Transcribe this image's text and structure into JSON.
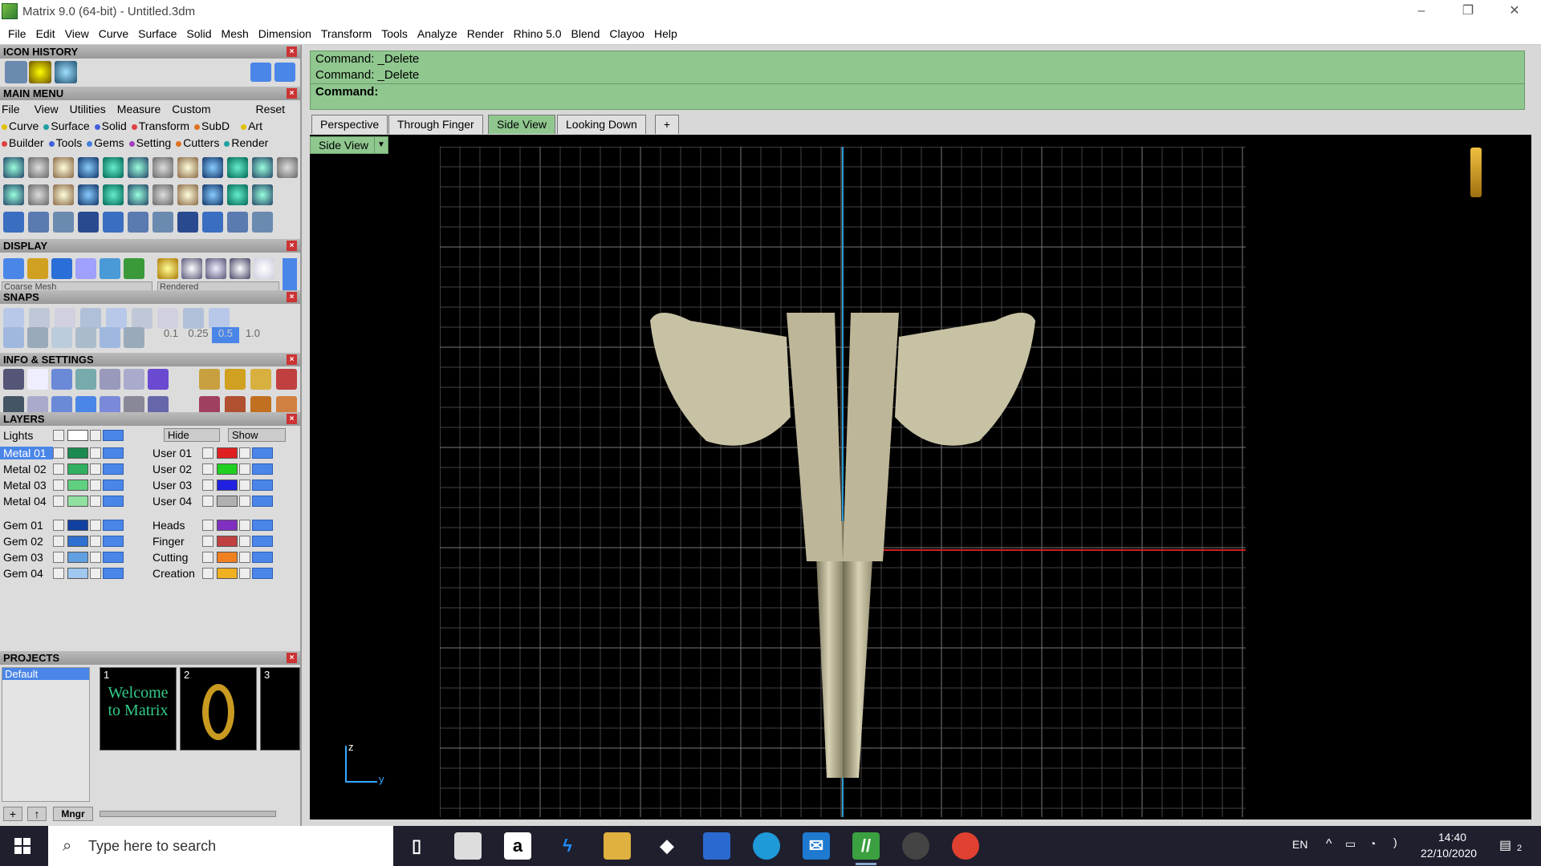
{
  "window": {
    "title": "Matrix 9.0 (64-bit) - Untitled.3dm",
    "minimize": "–",
    "restore": "❐",
    "close": "✕"
  },
  "menu": [
    "File",
    "Edit",
    "View",
    "Curve",
    "Surface",
    "Solid",
    "Mesh",
    "Dimension",
    "Transform",
    "Tools",
    "Analyze",
    "Render",
    "Rhino 5.0",
    "Blend",
    "Clayoo",
    "Help"
  ],
  "panel": {
    "icon_history": "ICON HISTORY",
    "main_menu": "MAIN MENU",
    "main_menu_items": [
      "File",
      "View",
      "Utilities",
      "Measure",
      "Custom"
    ],
    "reset": "Reset",
    "categories_row1": [
      {
        "label": "Curve",
        "color": "#e0c000"
      },
      {
        "label": "Surface",
        "color": "#20a0a0"
      },
      {
        "label": "Solid",
        "color": "#4060e0"
      },
      {
        "label": "Transform",
        "color": "#e04040"
      },
      {
        "label": "SubD",
        "color": "#e07020"
      },
      {
        "label": "Art",
        "color": "#e0c000"
      }
    ],
    "categories_row2": [
      {
        "label": "Builder",
        "color": "#e04040"
      },
      {
        "label": "Tools",
        "color": "#4060e0"
      },
      {
        "label": "Gems",
        "color": "#4080e0"
      },
      {
        "label": "Setting",
        "color": "#a040c0"
      },
      {
        "label": "Cutters",
        "color": "#e07020"
      },
      {
        "label": "Render",
        "color": "#20a0a0"
      }
    ],
    "display": "DISPLAY",
    "mesh_select": "Coarse Mesh",
    "render_select": "Rendered",
    "snaps": "SNAPS",
    "snap_values": [
      "0.1",
      "0.25",
      "0.5",
      "1.0"
    ],
    "info_settings": "INFO & SETTINGS",
    "layers": "LAYERS",
    "lights": "Lights",
    "hide": "Hide",
    "show": "Show",
    "layers_left": [
      {
        "name": "Metal 01",
        "color": "#1a8a50",
        "selected": true
      },
      {
        "name": "Metal 02",
        "color": "#30b060"
      },
      {
        "name": "Metal 03",
        "color": "#60d080"
      },
      {
        "name": "Metal 04",
        "color": "#90e0a0"
      },
      {
        "name": "Gem 01",
        "color": "#1040a0"
      },
      {
        "name": "Gem 02",
        "color": "#3070d0"
      },
      {
        "name": "Gem 03",
        "color": "#60a0e0"
      },
      {
        "name": "Gem 04",
        "color": "#a0c8f0"
      }
    ],
    "layers_right": [
      {
        "name": "User 01",
        "color": "#e02020"
      },
      {
        "name": "User 02",
        "color": "#20d020"
      },
      {
        "name": "User 03",
        "color": "#2020e0"
      },
      {
        "name": "User 04",
        "color": "#b0b0b0"
      },
      {
        "name": "Heads",
        "color": "#8030c0"
      },
      {
        "name": "Finger",
        "color": "#c04040"
      },
      {
        "name": "Cutting",
        "color": "#f08020"
      },
      {
        "name": "Creation",
        "color": "#f0b020"
      }
    ],
    "projects": "PROJECTS",
    "project_list": [
      "Default"
    ],
    "project_thumbs": [
      "1",
      "2",
      "3"
    ],
    "welcome_text": "Welcome to Matrix",
    "mngr": "Mngr"
  },
  "command": {
    "lines": [
      "Command: _Delete",
      "Command: _Delete"
    ],
    "prompt": "Command:"
  },
  "tabs": [
    "Perspective",
    "Through Finger",
    "Side View",
    "Looking Down"
  ],
  "active_tab": "Side View",
  "view_select": "Side View",
  "axis_z": "z",
  "axis_y": "y",
  "taskbar": {
    "search_placeholder": "Type here to search",
    "lang": "EN",
    "time": "14:40",
    "date": "22/10/2020",
    "notifications": "2"
  }
}
